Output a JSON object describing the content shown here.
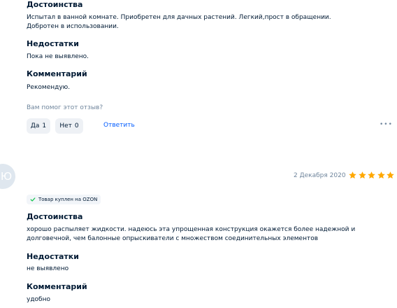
{
  "review1": {
    "pros_heading": "Достоинства",
    "pros_text": "Испытал в ванной комнате. Приобретен для дачных растений. Легкий,прост в обращении. Добротен в использовании.",
    "cons_heading": "Недостатки",
    "cons_text": "Пока не выявлено.",
    "comment_heading": "Комментарий",
    "comment_text": "Рекомендую.",
    "helpful_question": "Вам помог этот отзыв?",
    "yes_label": "Да",
    "yes_count": "1",
    "no_label": "Нет",
    "no_count": "0",
    "reply_label": "Ответить",
    "more_label": "•••"
  },
  "review2": {
    "avatar_letter": "Ю",
    "date": "2 Декабря 2020",
    "rating": 5,
    "star_color": "#ffa800",
    "verified_badge": "Товар куплен на OZON",
    "verified_color": "#10c44c",
    "pros_heading": "Достоинства",
    "pros_text": "хорошо распыляет жидкости. надеюсь эта упрощенная конструкция окажется более надежной и долговечной, чем балонные опрыскиватели с множеством соединительных элементов",
    "cons_heading": "Недостатки",
    "cons_text": "не выявлено",
    "comment_heading": "Комментарий",
    "comment_text": "удобно"
  }
}
